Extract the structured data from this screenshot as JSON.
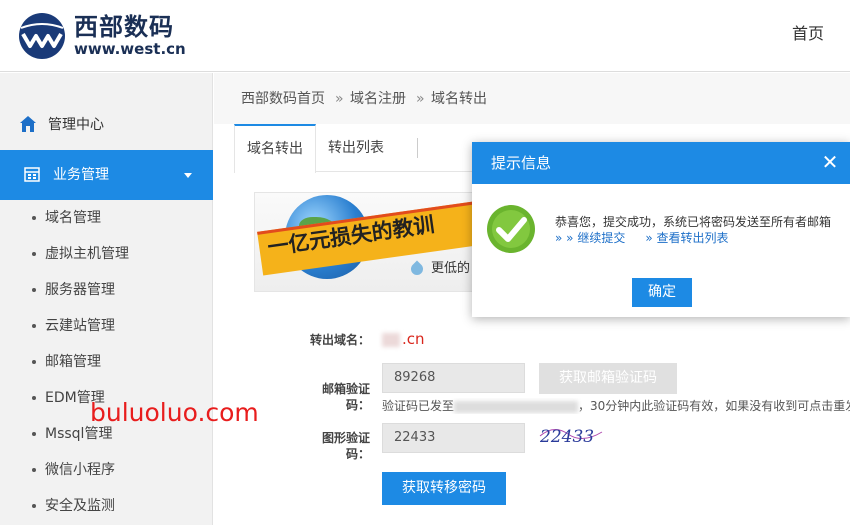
{
  "header": {
    "brand_cn": "西部数码",
    "brand_en": "www.west.cn",
    "home_link": "首页"
  },
  "sidebar": {
    "mgmt_center": "管理中心",
    "business": "业务管理",
    "items": [
      {
        "label": "域名管理"
      },
      {
        "label": "虚拟主机管理"
      },
      {
        "label": "服务器管理"
      },
      {
        "label": "云建站管理"
      },
      {
        "label": "邮箱管理"
      },
      {
        "label": "EDM管理"
      },
      {
        "label": "Mssql管理"
      },
      {
        "label": "微信小程序"
      },
      {
        "label": "安全及监测"
      }
    ]
  },
  "breadcrumb": {
    "home": "西部数码首页",
    "sep": "»",
    "level1": "域名注册",
    "level2": "域名转出"
  },
  "tabs": {
    "active": "域名转出",
    "list": "转出列表"
  },
  "banner": {
    "slogan": "一亿元损失的教训",
    "sub": "更低的"
  },
  "form": {
    "domain_label": "转出域名：",
    "domain_value": ".cn",
    "email_code_label": "邮箱验证码：",
    "email_code_value": "89268",
    "get_email_code_btn": "获取邮箱验证码",
    "hint_prefix": "验证码已发至",
    "hint_suffix": "，30分钟内此验证码有效，如果没有收到可点击重发",
    "captcha_label": "图形验证码：",
    "captcha_value": "22433",
    "captcha_image_text": "22433",
    "submit_btn": "获取转移密码"
  },
  "watermark": "buluoluo.com",
  "dialog": {
    "title": "提示信息",
    "close": "✕",
    "message": "恭喜您，提交成功，系统已将密码发送至所有者邮箱",
    "link_continue": "»  » 继续提交",
    "link_list": "» 查看转出列表",
    "ok_btn": "确定"
  },
  "colors": {
    "primary": "#1d8ae4",
    "brand_navy": "#1a2f55",
    "watermark_red": "#e81d1d",
    "success_green": "#6ab42e"
  }
}
